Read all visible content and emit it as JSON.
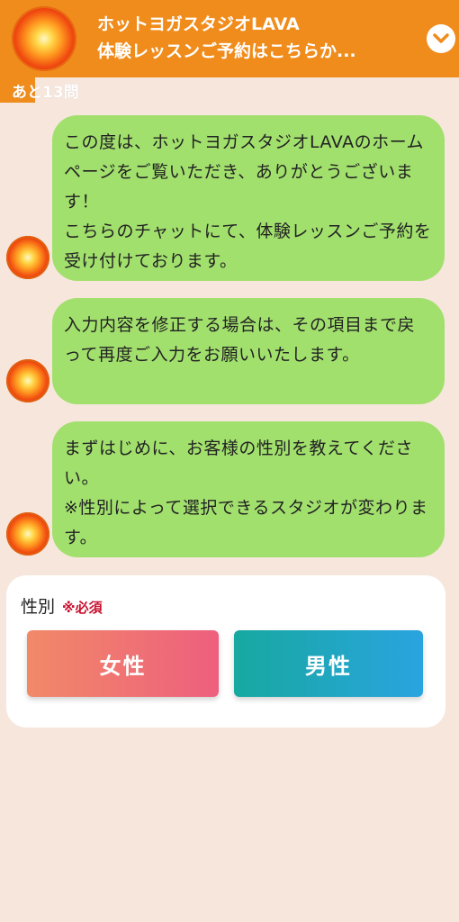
{
  "header": {
    "title_line1": "ホットヨガスタジオLAVA",
    "title_line2": "体験レッスンご予約はこちらか...",
    "toggle_icon": "chevron-down-icon",
    "color": "#f08c1c"
  },
  "progress": {
    "remaining_text": "あと13問"
  },
  "messages": [
    {
      "text": "この度は、ホットヨガスタジオLAVAのホームページをご覧いただき、ありがとうございます！\nこちらのチャットにて、体験レッスンご予約を受け付けております。"
    },
    {
      "text": "入力内容を修正する場合は、その項目まで戻って再度ご入力をお願いいたします。"
    },
    {
      "text": "まずはじめに、お客様の性別を教えてください。\n※性別によって選択できるスタジオが変わります。"
    }
  ],
  "form": {
    "label": "性別",
    "required": "※必須",
    "options": [
      "女性",
      "男性"
    ]
  },
  "colors": {
    "bubble": "#a2e06e",
    "background": "#f6e6dc",
    "required": "#c8102e"
  }
}
